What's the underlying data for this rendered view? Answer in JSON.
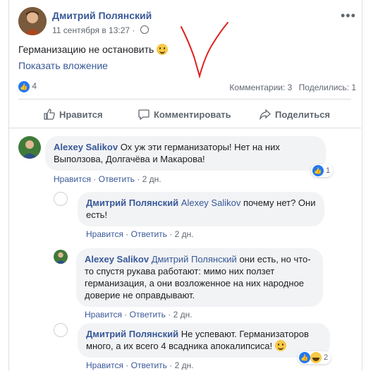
{
  "post": {
    "author": "Дмитрий Полянский",
    "date": "11 сентября в 13:27",
    "separator": "·",
    "text": "Германизацию не остановить",
    "attachment_link": "Показать вложение",
    "reaction_count": "4",
    "comments_stat": "Комментарии: 3",
    "shares_stat": "Поделились: 1"
  },
  "actions": {
    "like": "Нравится",
    "comment": "Комментировать",
    "share": "Поделиться"
  },
  "comments": [
    {
      "author": "Alexey Salikov",
      "text": "Ох уж эти германизаторы! Нет на них Выползова, Долгачёва и Макарова!",
      "like": "Нравится",
      "reply": "Ответить",
      "time": "2 дн.",
      "reactions": "1"
    },
    {
      "author": "Дмитрий Полянский",
      "mention": "Alexey Salikov",
      "text": "почему нет? Они есть!",
      "like": "Нравится",
      "reply": "Ответить",
      "time": "2 дн."
    },
    {
      "author": "Alexey Salikov",
      "mention": "Дмитрий Полянский",
      "text": "они есть, но что-то спустя рукава работают: мимо них ползет германизация, а они возложенное на них народное доверие не оправдывают.",
      "like": "Нравится",
      "reply": "Ответить",
      "time": "2 дн."
    },
    {
      "author": "Дмитрий Полянский",
      "text": "Не успевают. Германизаторов много, а их всего 4 всадника апокалипсиса!",
      "like": "Нравится",
      "reply": "Ответить",
      "time": "2 дн.",
      "reactions": "2"
    }
  ],
  "colors": {
    "link": "#385898",
    "like_blue": "#2078f4",
    "bubble": "#f2f3f5",
    "annotation": "#e0201e"
  },
  "icons": [
    "globe-icon",
    "more-dots-icon",
    "thumbs-up-icon",
    "comment-icon",
    "share-icon",
    "smile-emoji",
    "haha-emoji"
  ]
}
